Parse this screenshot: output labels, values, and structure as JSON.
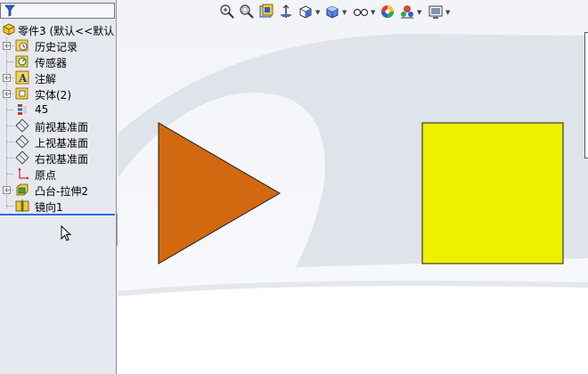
{
  "tree": {
    "root_label": "零件3 (默认<<默认",
    "items": [
      {
        "label": "历史记录",
        "icon": "history-icon",
        "expandable": true
      },
      {
        "label": "传感器",
        "icon": "sensor-icon",
        "expandable": false
      },
      {
        "label": "注解",
        "icon": "annotation-icon",
        "expandable": true
      },
      {
        "label": "实体(2)",
        "icon": "solid-bodies-icon",
        "expandable": true
      },
      {
        "label": "45",
        "icon": "material-icon",
        "expandable": false
      },
      {
        "label": "前视基准面",
        "icon": "plane-icon",
        "expandable": false
      },
      {
        "label": "上视基准面",
        "icon": "plane-icon",
        "expandable": false
      },
      {
        "label": "右视基准面",
        "icon": "plane-icon",
        "expandable": false
      },
      {
        "label": "原点",
        "icon": "origin-icon",
        "expandable": false
      },
      {
        "label": "凸台-拉伸2",
        "icon": "extrude-icon",
        "expandable": true
      },
      {
        "label": "镜向1",
        "icon": "mirror-icon",
        "expandable": false
      }
    ]
  },
  "toolbar": {
    "buttons": [
      {
        "name": "zoom-to-fit-icon"
      },
      {
        "name": "zoom-to-area-icon"
      },
      {
        "name": "previous-view-icon"
      },
      {
        "name": "section-view-icon"
      },
      {
        "name": "view-orientation-icon"
      },
      {
        "name": "display-style-icon"
      },
      {
        "name": "hide-show-items-icon"
      },
      {
        "name": "edit-appearance-icon"
      },
      {
        "name": "apply-scene-icon"
      },
      {
        "name": "view-settings-icon"
      }
    ]
  },
  "colors": {
    "triangle_fill": "#d2680f",
    "square_fill": "#eef000",
    "background_shape": "#d9dee7",
    "tree_background": "#e7e9f1",
    "rollback_bar": "#2b6fd6"
  }
}
